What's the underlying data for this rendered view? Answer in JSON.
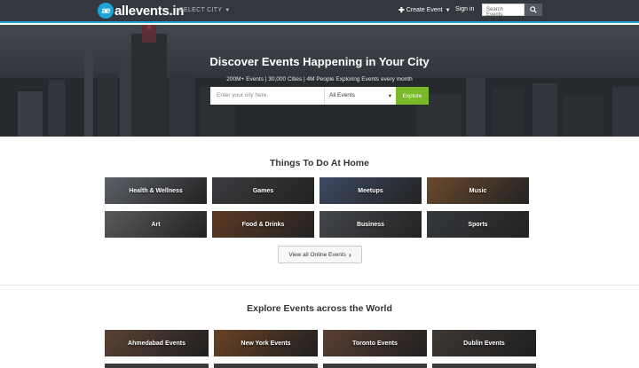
{
  "header": {
    "logo_badge": "ae",
    "logo_text": "allevents.in",
    "select_city": "SELECT CITY",
    "create_event": "Create Event",
    "sign_in": "Sign in",
    "search_placeholder": "Search Events",
    "accent_color": "#1aa4d8"
  },
  "hero": {
    "title": "Discover Events Happening in Your City",
    "subtitle": "200M+ Events  |  30,000 Cities  |  4M People Exploring Events every month",
    "city_placeholder": "Enter your city here",
    "events_select": "All Events",
    "explore_button": "Explore",
    "explore_color": "#7ab928"
  },
  "home": {
    "title": "Things To Do At Home",
    "categories": [
      {
        "label": "Health & Wellness",
        "color": "#5d6168"
      },
      {
        "label": "Games",
        "color": "#3a3c3f"
      },
      {
        "label": "Meetups",
        "color": "#3d4a63"
      },
      {
        "label": "Music",
        "color": "#6b4a2c"
      },
      {
        "label": "Art",
        "color": "#5a5a58"
      },
      {
        "label": "Food & Drinks",
        "color": "#5e3a22"
      },
      {
        "label": "Business",
        "color": "#45484d"
      },
      {
        "label": "Sports",
        "color": "#36393d"
      }
    ],
    "view_all": "View all Online Events"
  },
  "world": {
    "title": "Explore Events across the World",
    "cities": [
      {
        "label": "Ahmedabad Events",
        "color": "#5b4335"
      },
      {
        "label": "New York Events",
        "color": "#6a4325"
      },
      {
        "label": "Toronto Events",
        "color": "#5a3f33"
      },
      {
        "label": "Dublin Events",
        "color": "#3f3834"
      }
    ]
  }
}
